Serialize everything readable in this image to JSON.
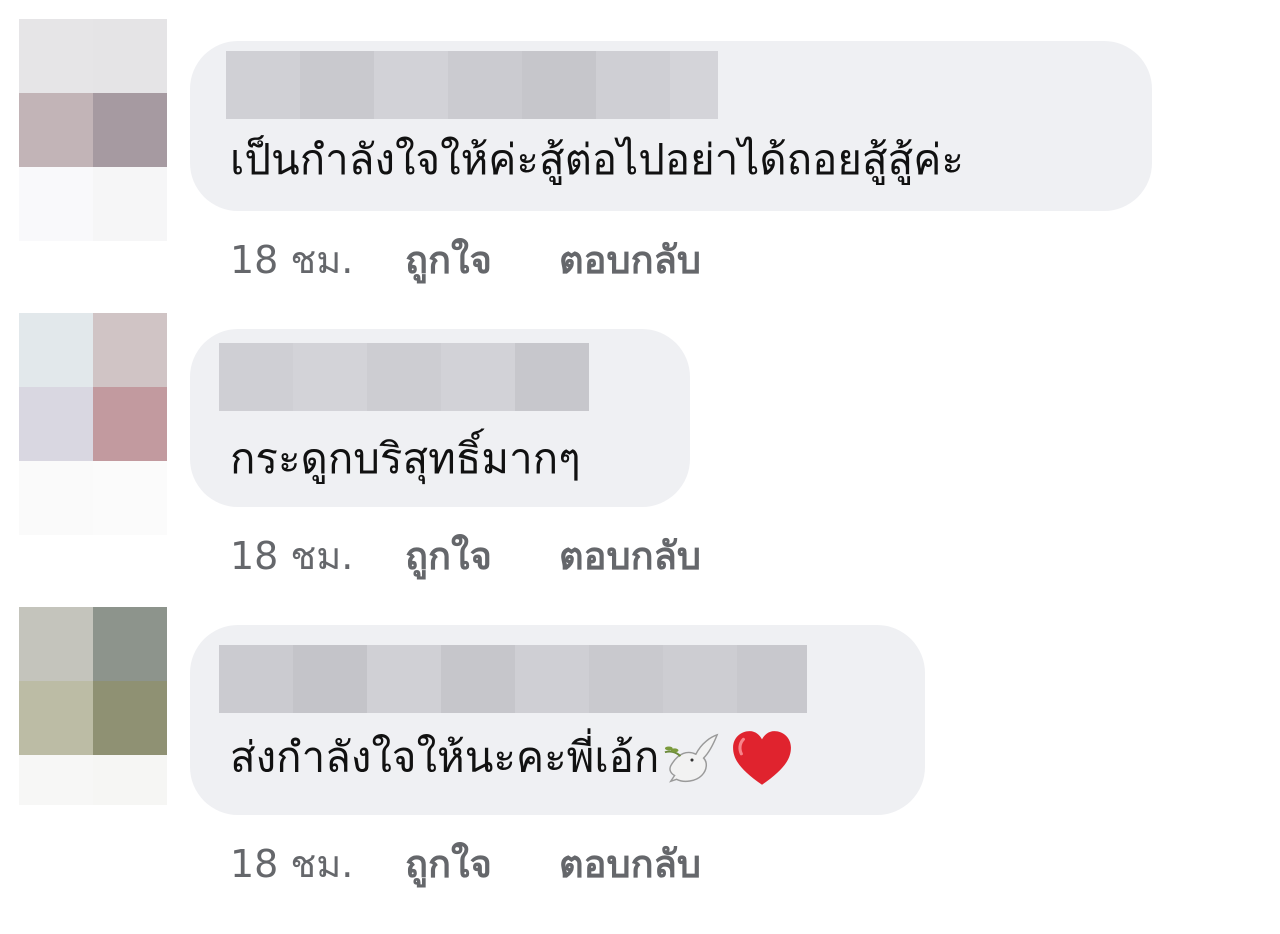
{
  "comments": [
    {
      "text": "เป็นกำลังใจให้ค่ะสู้ต่อไปอย่าได้ถอยสู้สู้ค่ะ",
      "time": "18 ชม.",
      "like_label": "ถูกใจ",
      "reply_label": "ตอบกลับ",
      "avatar_colors": [
        "#e6e5e7",
        "#e5e4e6",
        "#c2b4b7",
        "#a69aa1",
        "#f9f9fb",
        "#f6f6f7"
      ],
      "emoji": []
    },
    {
      "text": "กระดูกบริสุทธิ์มากๆ",
      "time": "18 ชม.",
      "like_label": "ถูกใจ",
      "reply_label": "ตอบกลับ",
      "avatar_colors": [
        "#e2e8eb",
        "#d0c4c5",
        "#d9d7e1",
        "#c29a9f",
        "#fafafa",
        "#fbfbfb"
      ],
      "emoji": []
    },
    {
      "text": "ส่งกำลังใจให้นะคะพี่เอ้ก",
      "time": "18 ชม.",
      "like_label": "ถูกใจ",
      "reply_label": "ตอบกลับ",
      "avatar_colors": [
        "#c4c4bc",
        "#8d948c",
        "#bcbca5",
        "#8f9173",
        "#f7f7f6",
        "#f6f6f4"
      ],
      "emoji": [
        "dove-icon",
        "heart-icon"
      ]
    }
  ],
  "colors": {
    "bubble_bg": "#eff0f3",
    "name_blur_a": "#d0d0d5",
    "name_blur_b": "#c6c6cb",
    "meta_text": "#65676b",
    "heart_red": "#e0232e"
  }
}
